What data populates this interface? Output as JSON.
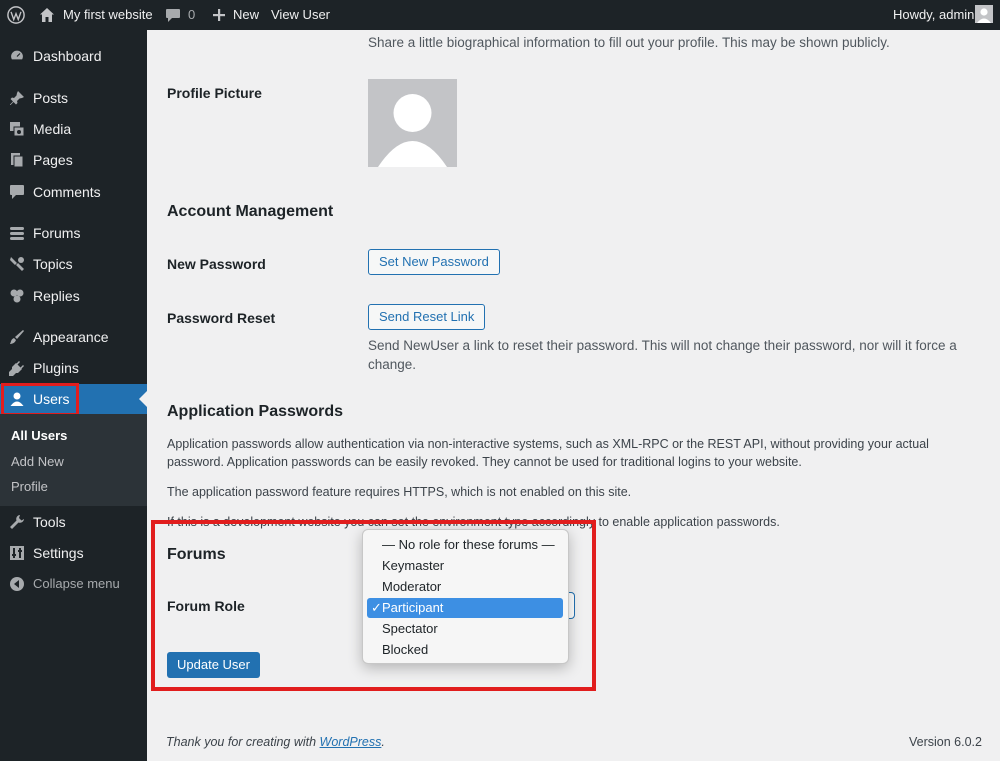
{
  "admin_bar": {
    "site_name": "My first website",
    "comment_count": "0",
    "new_label": "New",
    "view_user_label": "View User",
    "greeting": "Howdy, admin"
  },
  "sidebar": {
    "items": [
      {
        "label": "Dashboard",
        "icon": "dashboard-icon"
      },
      {
        "label": "Posts",
        "icon": "pin-icon"
      },
      {
        "label": "Media",
        "icon": "media-icon"
      },
      {
        "label": "Pages",
        "icon": "pages-icon"
      },
      {
        "label": "Comments",
        "icon": "comment-icon"
      },
      {
        "label": "Forums",
        "icon": "forums-icon"
      },
      {
        "label": "Topics",
        "icon": "topics-icon"
      },
      {
        "label": "Replies",
        "icon": "replies-icon"
      },
      {
        "label": "Appearance",
        "icon": "brush-icon"
      },
      {
        "label": "Plugins",
        "icon": "plug-icon"
      },
      {
        "label": "Users",
        "icon": "user-icon"
      },
      {
        "label": "Tools",
        "icon": "wrench-icon"
      },
      {
        "label": "Settings",
        "icon": "settings-icon"
      },
      {
        "label": "Collapse menu",
        "icon": "collapse-icon"
      }
    ],
    "users_submenu": [
      "All Users",
      "Add New",
      "Profile"
    ]
  },
  "profile": {
    "bio_description": "Share a little biographical information to fill out your profile. This may be shown publicly.",
    "profile_picture_label": "Profile Picture"
  },
  "account": {
    "heading": "Account Management",
    "new_password_label": "New Password",
    "set_password_button": "Set New Password",
    "password_reset_label": "Password Reset",
    "send_reset_button": "Send Reset Link",
    "reset_description_1": "Send NewUser a link to reset their password. This will not change their password, nor will it force a",
    "reset_description_2": "change."
  },
  "app_passwords": {
    "heading": "Application Passwords",
    "para1_line1": "Application passwords allow authentication via non-interactive systems, such as XML-RPC or the REST API, without providing your actual",
    "para1_line2": "password. Application passwords can be easily revoked. They cannot be used for traditional logins to your website.",
    "para2": "The application password feature requires HTTPS, which is not enabled on this site.",
    "para3": "If this is a development website you can set the environment type accordingly to enable application passwords."
  },
  "forums": {
    "heading": "Forums",
    "role_label": "Forum Role",
    "role_options": [
      "— No role for these forums —",
      "Keymaster",
      "Moderator",
      "Participant",
      "Spectator",
      "Blocked"
    ],
    "selected_role": "Participant",
    "check_mark": "✓"
  },
  "update_button": "Update User",
  "footer": {
    "thanks_prefix": "Thank you for creating with ",
    "wordpress_link": "WordPress",
    "thanks_suffix": ".",
    "version": "Version 6.0.2"
  },
  "colors": {
    "accent": "#2271b1",
    "highlight": "#e11d1d",
    "adminbar": "#1d2327"
  }
}
